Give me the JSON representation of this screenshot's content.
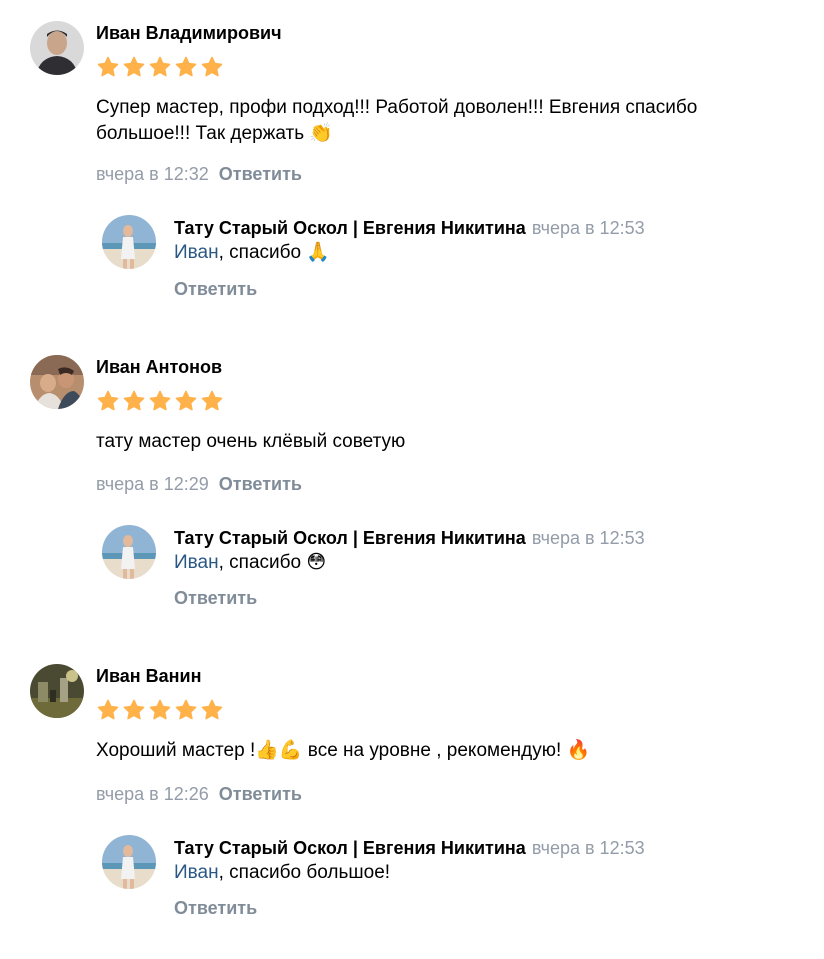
{
  "accent_link_color": "#2a5885",
  "muted_color": "#818c99",
  "star_color": "#ffb14a",
  "reviews": [
    {
      "author": "Иван Владимирович",
      "rating": 5,
      "text": "Супер мастер, профи подход!!! Работой доволен!!! Евгения спасибо большое!!! Так держать 👏",
      "date": "вчера в 12:32",
      "reply_label": "Ответить",
      "reply": {
        "author": "Тату Старый Оскол | Евгения Никитина",
        "date": "вчера в 12:53",
        "mention": "Иван",
        "text": ", спасибо 🙏",
        "reply_label": "Ответить"
      }
    },
    {
      "author": "Иван Антонов",
      "rating": 5,
      "text": "тату мастер очень клёвый советую",
      "date": "вчера в 12:29",
      "reply_label": "Ответить",
      "reply": {
        "author": "Тату Старый Оскол | Евгения Никитина",
        "date": "вчера в 12:53",
        "mention": "Иван",
        "text": ", спасибо 😳",
        "reply_label": "Ответить"
      }
    },
    {
      "author": "Иван Ванин",
      "rating": 5,
      "text": "Хороший мастер !👍💪 все на уровне , рекомендую! 🔥",
      "date": "вчера в 12:26",
      "reply_label": "Ответить",
      "reply": {
        "author": "Тату Старый Оскол | Евгения Никитина",
        "date": "вчера в 12:53",
        "mention": "Иван",
        "text": ", спасибо большое!",
        "reply_label": "Ответить"
      }
    }
  ]
}
